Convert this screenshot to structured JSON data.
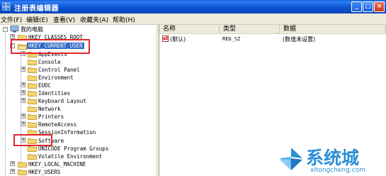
{
  "window": {
    "title": "注册表编辑器"
  },
  "menu": [
    "文件(F)",
    "编辑(E)",
    "查看(V)",
    "收藏夹(A)",
    "帮助(H)"
  ],
  "tree": {
    "root": "我的电脑",
    "items": [
      {
        "label": "HKEY_CLASSES_ROOT",
        "level": 1,
        "expander": "+"
      },
      {
        "label": "HKEY_CURRENT_USER",
        "level": 1,
        "expander": "-",
        "selected": true
      },
      {
        "label": "AppEvents",
        "level": 2,
        "expander": "+"
      },
      {
        "label": "Console",
        "level": 2,
        "expander": ""
      },
      {
        "label": "Control Panel",
        "level": 2,
        "expander": "+"
      },
      {
        "label": "Environment",
        "level": 2,
        "expander": ""
      },
      {
        "label": "EUDC",
        "level": 2,
        "expander": "+"
      },
      {
        "label": "Identities",
        "level": 2,
        "expander": "+"
      },
      {
        "label": "Keyboard Layout",
        "level": 2,
        "expander": "+"
      },
      {
        "label": "Network",
        "level": 2,
        "expander": ""
      },
      {
        "label": "Printers",
        "level": 2,
        "expander": "+"
      },
      {
        "label": "RemoteAccess",
        "level": 2,
        "expander": "+"
      },
      {
        "label": "SessionInformation",
        "level": 2,
        "expander": ""
      },
      {
        "label": "Software",
        "level": 2,
        "expander": "+"
      },
      {
        "label": "UNICODE Program Groups",
        "level": 2,
        "expander": ""
      },
      {
        "label": "Volatile Environment",
        "level": 2,
        "expander": ""
      },
      {
        "label": "HKEY_LOCAL_MACHINE",
        "level": 1,
        "expander": "+"
      },
      {
        "label": "HKEY_USERS",
        "level": 1,
        "expander": "+"
      }
    ]
  },
  "list": {
    "columns": [
      "名称",
      "类型",
      "数据"
    ],
    "rows": [
      {
        "name": "(默认)",
        "type": "REG_SZ",
        "data": "(数值未设置)"
      }
    ]
  },
  "watermark": {
    "name": "系统城",
    "url": "xitongcheng.com"
  }
}
